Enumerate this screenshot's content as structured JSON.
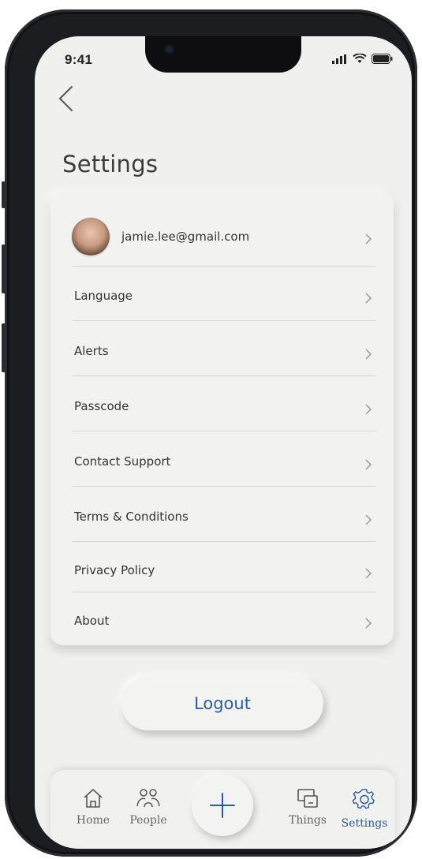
{
  "status_bar": {
    "time": "9:41"
  },
  "page": {
    "title": "Settings"
  },
  "account": {
    "email": "jamie.lee@gmail.com"
  },
  "settings_items": [
    {
      "label": "Language"
    },
    {
      "label": "Alerts"
    },
    {
      "label": "Passcode"
    },
    {
      "label": "Contact Support"
    },
    {
      "label": "Terms & Conditions"
    },
    {
      "label": "Privacy Policy"
    },
    {
      "label": "About"
    }
  ],
  "logout": {
    "label": "Logout"
  },
  "tabbar": {
    "tabs": [
      {
        "label": "Home",
        "icon": "home-icon"
      },
      {
        "label": "People",
        "icon": "people-icon"
      },
      {
        "label": "Things",
        "icon": "devices-icon"
      },
      {
        "label": "Settings",
        "icon": "gear-icon"
      }
    ],
    "add_icon": "plus-icon",
    "active_tab": "Settings"
  },
  "colors": {
    "accent": "#2e5c9a",
    "background": "#f0f0ef",
    "text": "#333333"
  }
}
